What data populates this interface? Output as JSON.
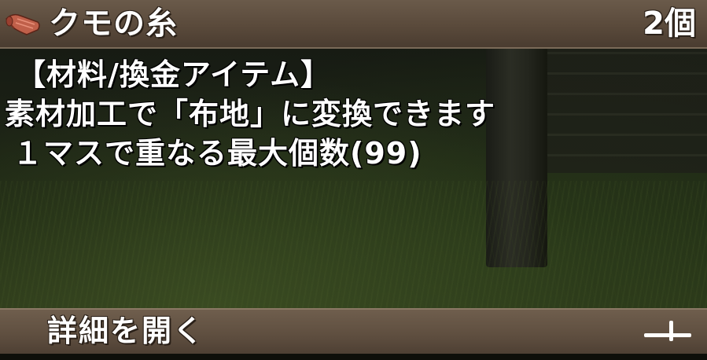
{
  "item": {
    "name": "クモの糸",
    "count": "2個",
    "icon": "cloth-roll-icon"
  },
  "description": {
    "category": "【材料/換金アイテム】",
    "line2": "素材加工で「布地」に変換できます",
    "line3": "１マスで重なる最大個数(99)"
  },
  "footer": {
    "detail_label": "詳細を開く",
    "expand_icon": "plus-icon"
  },
  "colors": {
    "panel": "#5a4a3b",
    "text": "#ffffff",
    "icon": "#c0604a"
  }
}
